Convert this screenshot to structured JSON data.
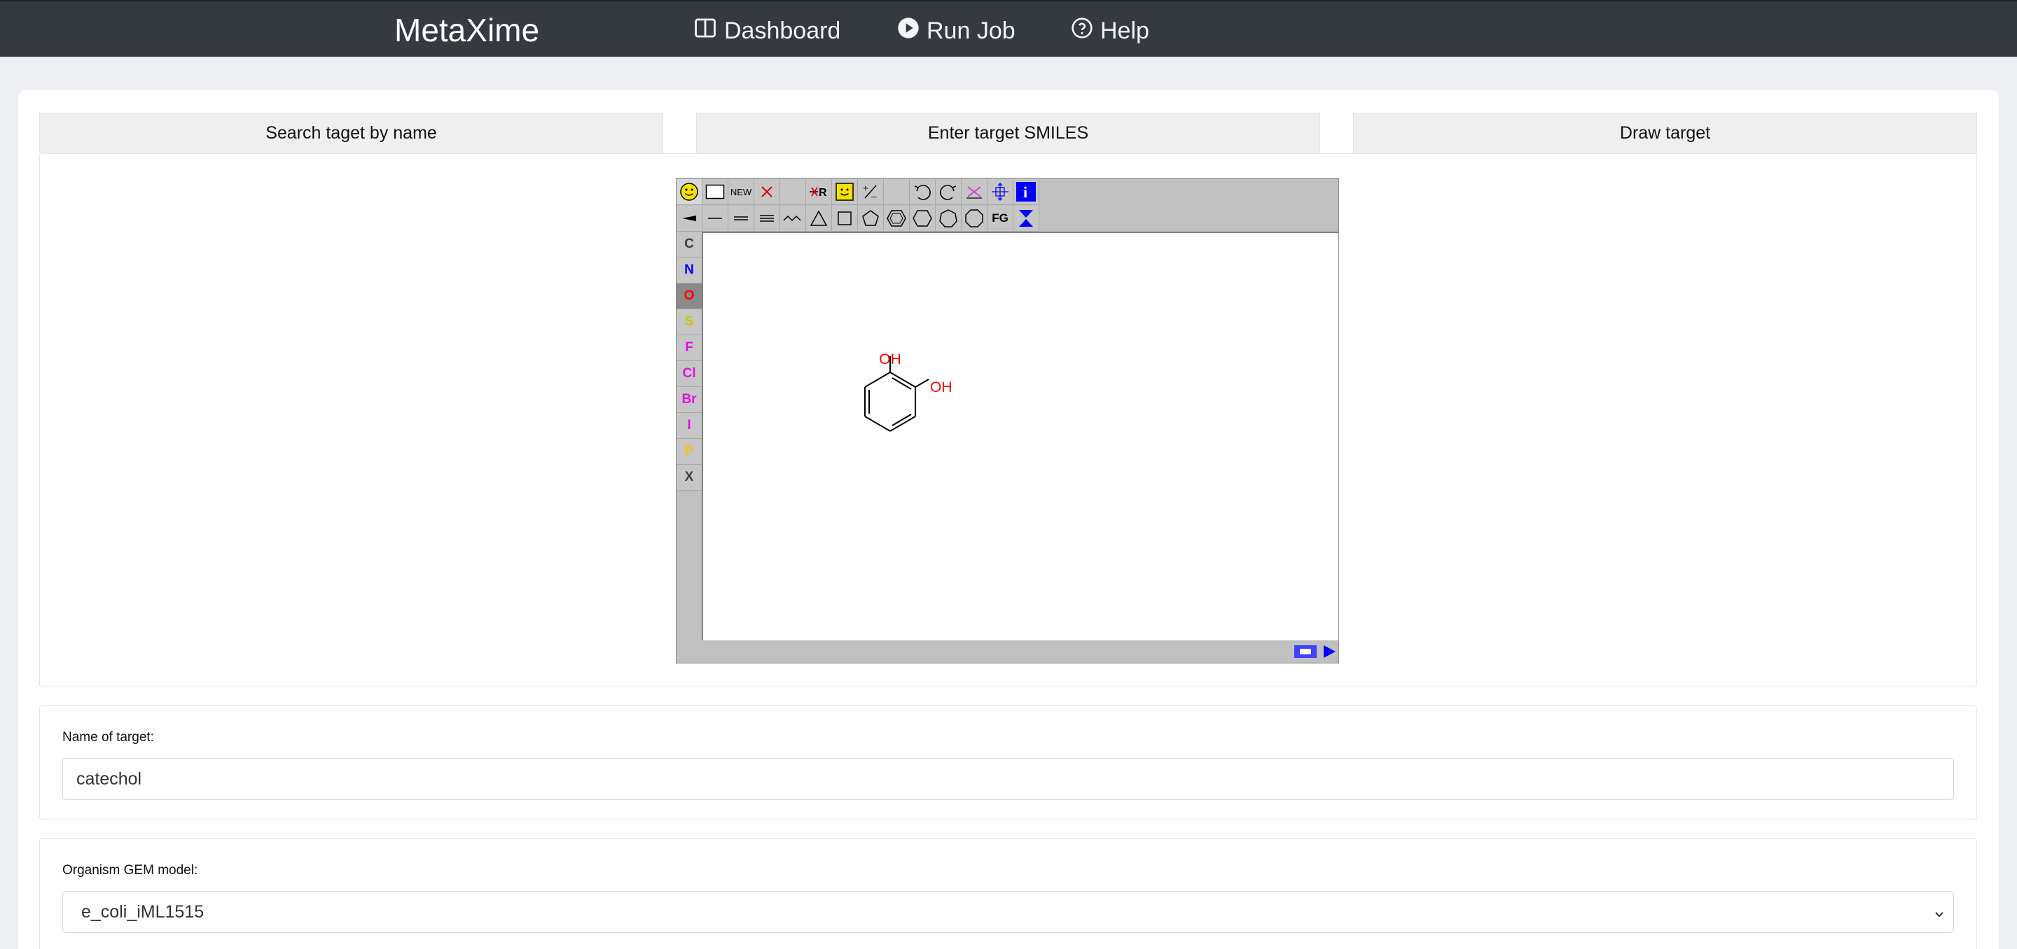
{
  "navbar": {
    "brand": "MetaXime",
    "items": [
      {
        "label": "Dashboard",
        "icon": "columns-icon"
      },
      {
        "label": "Run Job",
        "icon": "play-circle-icon"
      },
      {
        "label": "Help",
        "icon": "question-circle-icon"
      }
    ]
  },
  "tabs": [
    {
      "label": "Search taget by name"
    },
    {
      "label": "Enter target SMILES"
    },
    {
      "label": "Draw target"
    }
  ],
  "editor": {
    "toolbar_row1": [
      "smiley-icon",
      "rectangle-select-icon",
      "NEW",
      "delete-icon",
      "",
      "delete-r-group-icon",
      "template-icon",
      "charge-icon",
      "",
      "undo-icon",
      "redo-icon",
      "clear-icon",
      "move-icon",
      "info-icon"
    ],
    "new_label": "NEW",
    "fg_label": "FG",
    "atoms": [
      {
        "symbol": "C",
        "color": "#404040"
      },
      {
        "symbol": "N",
        "color": "#0000ff"
      },
      {
        "symbol": "O",
        "color": "#ff0000"
      },
      {
        "symbol": "S",
        "color": "#c8c800"
      },
      {
        "symbol": "F",
        "color": "#e010e0"
      },
      {
        "symbol": "Cl",
        "color": "#e010e0"
      },
      {
        "symbol": "Br",
        "color": "#e010e0"
      },
      {
        "symbol": "I",
        "color": "#e010e0"
      },
      {
        "symbol": "P",
        "color": "#ffc000"
      },
      {
        "symbol": "X",
        "color": "#404040"
      }
    ],
    "molecule_labels": [
      "OH",
      "OH"
    ],
    "molecule_color": "#ff0000"
  },
  "name_section": {
    "label": "Name of target:",
    "value": "catechol"
  },
  "organism_section": {
    "label": "Organism GEM model:",
    "selected": "e_coli_iML1515"
  }
}
